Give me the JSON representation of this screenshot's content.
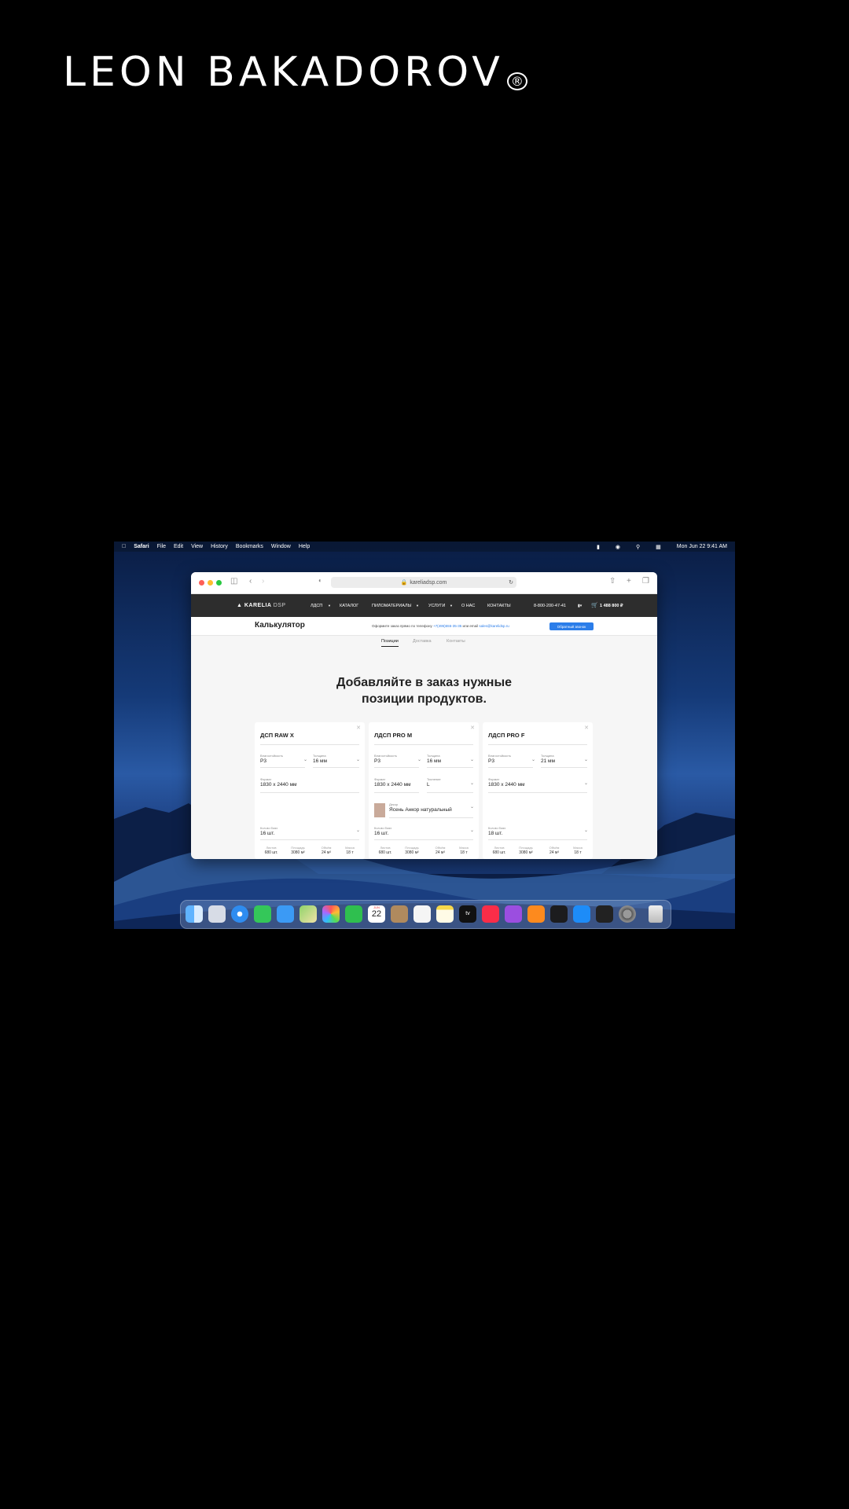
{
  "brand": {
    "name": "LEON BAKADOROV",
    "mark": "®"
  },
  "menubar": {
    "items": [
      "Safari",
      "File",
      "Edit",
      "View",
      "History",
      "Bookmarks",
      "Window",
      "Help"
    ],
    "datetime": "Mon Jun 22  9:41 AM"
  },
  "browser": {
    "url": "kareliadsp.com"
  },
  "site": {
    "logo_bold": "KARELIA",
    "logo_thin": "DSP",
    "nav": [
      "ЛДСП",
      "КАТАЛОГ",
      "ПИЛОМАТЕРИАЛЫ",
      "УСЛУГИ",
      "О НАС",
      "КОНТАКТЫ"
    ],
    "phone": "8-800-200-47-41",
    "cart_total": "1 488 800 ₽"
  },
  "subheader": {
    "title": "Калькулятор",
    "info_prefix": "Оформите заказ прямо по телефону",
    "info_phone": "+7(495)555-35-35",
    "info_mid": "или email",
    "info_email": "sales@karelidsp.ru",
    "callback_label": "Обратный звонок"
  },
  "tabs": [
    "Позиции",
    "Доставка",
    "Контакты"
  ],
  "headline": {
    "line1": "Добавляйте в заказ нужные",
    "line2": "позиции продуктов."
  },
  "cards": [
    {
      "name": "ДСП RAW X",
      "moisture_label": "Влагостойкость",
      "moisture": "P3",
      "thickness_label": "Толщина",
      "thickness": "16 мм",
      "format_label": "Формат",
      "format": "1830 x 2440 мм",
      "qty_label": "Кол-во боях",
      "qty": "16 шт.",
      "stats": [
        {
          "label": "Листов",
          "value": "680 шт."
        },
        {
          "label": "Площадь",
          "value": "3080 м²"
        },
        {
          "label": "Объём",
          "value": "24 м³"
        },
        {
          "label": "Масса",
          "value": "18 т"
        }
      ]
    },
    {
      "name": "ЛДСП PRO M",
      "moisture_label": "Влагостойкость",
      "moisture": "P3",
      "thickness_label": "Толщина",
      "thickness": "16 мм",
      "format_label": "Формат",
      "format": "1830 x 2440 мм",
      "texture_label": "Тиснение",
      "texture": "L",
      "decor_label": "Декор",
      "decor": "Ясень Анкор натуральный",
      "qty_label": "Кол-во боях",
      "qty": "16 шт.",
      "stats": [
        {
          "label": "Листов",
          "value": "680 шт."
        },
        {
          "label": "Площадь",
          "value": "3080 м²"
        },
        {
          "label": "Объём",
          "value": "24 м³"
        },
        {
          "label": "Масса",
          "value": "18 т"
        }
      ]
    },
    {
      "name": "ЛДСП PRO F",
      "moisture_label": "Влагостойкость",
      "moisture": "P3",
      "thickness_label": "Толщина",
      "thickness": "21 мм",
      "format_label": "Формат",
      "format": "1830 x 2440 мм",
      "qty_label": "Кол-во боях",
      "qty": "18 шт.",
      "stats": [
        {
          "label": "Листов",
          "value": "680 шт."
        },
        {
          "label": "Площадь",
          "value": "3080 м²"
        },
        {
          "label": "Объём",
          "value": "24 м³"
        },
        {
          "label": "Масса",
          "value": "18 т"
        }
      ]
    }
  ],
  "dock": {
    "calendar_month": "JUN",
    "calendar_day": "22",
    "tv_label": "tv",
    "apps": [
      "finder-icon",
      "launchpad-icon",
      "safari-icon",
      "messages-icon",
      "mail-icon",
      "maps-icon",
      "photos-icon",
      "facetime-icon",
      "calendar-icon",
      "contacts-icon",
      "reminders-icon",
      "notes-icon",
      "tv-icon",
      "music-icon",
      "podcasts-icon",
      "books-icon",
      "voice-memos-icon",
      "app-store-icon",
      "terminal-icon",
      "system-preferences-icon",
      "trash-icon"
    ]
  }
}
